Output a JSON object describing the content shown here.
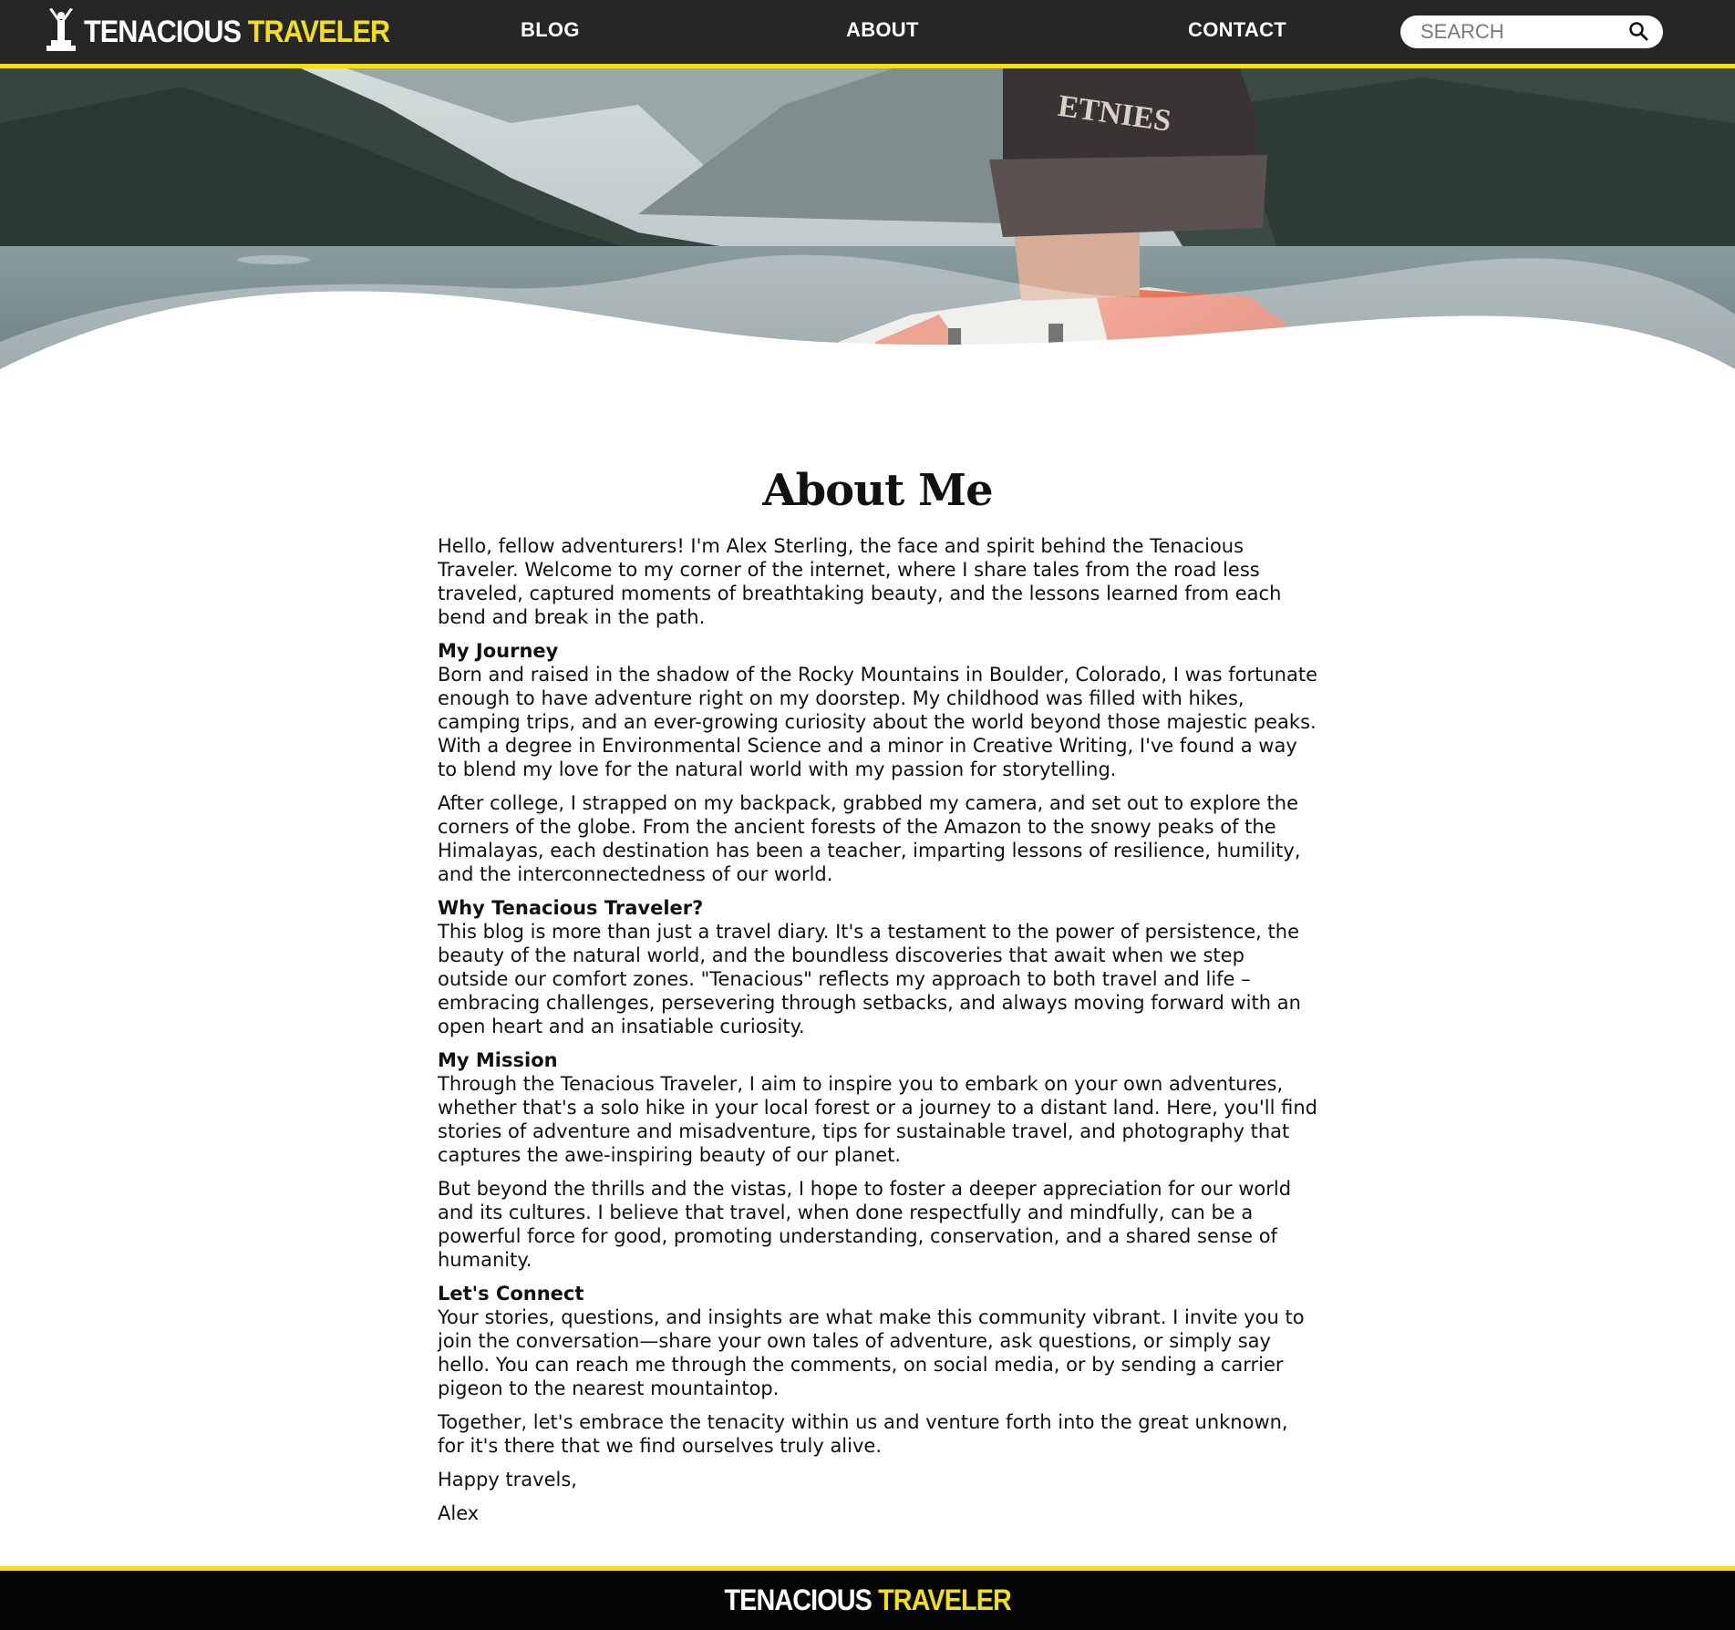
{
  "brand": {
    "word1": "TENACIOUS",
    "word2": "TRAVELER",
    "accent_color": "#f2de1b",
    "header_bg": "#262626"
  },
  "nav": {
    "items": [
      {
        "label": "BLOG"
      },
      {
        "label": "ABOUT"
      },
      {
        "label": "CONTACT"
      }
    ]
  },
  "search": {
    "placeholder": "SEARCH",
    "icon": "search-icon"
  },
  "hero": {
    "icon": "traveler-cap-backpack-lake-photo"
  },
  "main": {
    "title": "About Me",
    "intro": "Hello, fellow adventurers! I'm Alex Sterling, the face and spirit behind the Tenacious Traveler. Welcome to my corner of the internet, where I share tales from the road less traveled, captured moments of breathtaking beauty, and the lessons learned from each bend and break in the path.",
    "journey_heading": "My Journey",
    "journey_p1": "Born and raised in the shadow of the Rocky Mountains in Boulder, Colorado, I was fortunate enough to have adventure right on my doorstep. My childhood was filled with hikes, camping trips, and an ever-growing curiosity about the world beyond those majestic peaks. With a degree in Environmental Science and a minor in Creative Writing, I've found a way to blend my love for the natural world with my passion for storytelling.",
    "journey_p2": "After college, I strapped on my backpack, grabbed my camera, and set out to explore the corners of the globe. From the ancient forests of the Amazon to the snowy peaks of the Himalayas, each destination has been a teacher, imparting lessons of resilience, humility, and the interconnectedness of our world.",
    "why_heading": "Why Tenacious Traveler?",
    "why_p1": "This blog is more than just a travel diary. It's a testament to the power of persistence, the beauty of the natural world, and the boundless discoveries that await when we step outside our comfort zones. \"Tenacious\" reflects my approach to both travel and life – embracing challenges, persevering through setbacks, and always moving forward with an open heart and an insatiable curiosity.",
    "mission_heading": "My Mission",
    "mission_p1": "Through the Tenacious Traveler, I aim to inspire you to embark on your own adventures, whether that's a solo hike in your local forest or a journey to a distant land. Here, you'll find stories of adventure and misadventure, tips for sustainable travel, and photography that captures the awe-inspiring beauty of our planet.",
    "mission_p2": "But beyond the thrills and the vistas, I hope to foster a deeper appreciation for our world and its cultures. I believe that travel, when done respectfully and mindfully, can be a powerful force for good, promoting understanding, conservation, and a shared sense of humanity.",
    "connect_heading": "Let's Connect",
    "connect_p1": "Your stories, questions, and insights are what make this community vibrant. I invite you to join the conversation—share your own tales of adventure, ask questions, or simply say hello. You can reach me through the comments, on social media, or by sending a carrier pigeon to the nearest mountaintop.",
    "connect_p2": "Together, let's embrace the tenacity within us and venture forth into the great unknown, for it's there that we find ourselves truly alive.",
    "signoff": "Happy travels,",
    "signature": "Alex"
  },
  "footer": {
    "word1": "TENACIOUS",
    "word2": "TRAVELER"
  }
}
